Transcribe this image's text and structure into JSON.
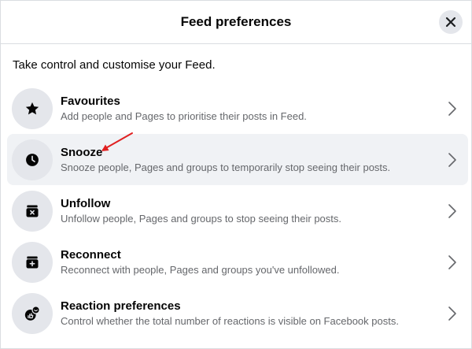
{
  "header": {
    "title": "Feed preferences",
    "close_icon": "close-icon"
  },
  "intro": "Take control and customise your Feed.",
  "items": [
    {
      "title": "Favourites",
      "description": "Add people and Pages to prioritise their posts in Feed.",
      "icon": "star-icon",
      "highlighted": false
    },
    {
      "title": "Snooze",
      "description": "Snooze people, Pages and groups to temporarily stop seeing their posts.",
      "icon": "clock-icon",
      "highlighted": true
    },
    {
      "title": "Unfollow",
      "description": "Unfollow people, Pages and groups to stop seeing their posts.",
      "icon": "unfollow-box-icon",
      "highlighted": false
    },
    {
      "title": "Reconnect",
      "description": "Reconnect with people, Pages and groups you've unfollowed.",
      "icon": "reconnect-box-icon",
      "highlighted": false
    },
    {
      "title": "Reaction preferences",
      "description": "Control whether the total number of reactions is visible on Facebook posts.",
      "icon": "reaction-icon",
      "highlighted": false
    }
  ],
  "colors": {
    "highlight_bg": "#f0f2f5",
    "icon_bg": "#e4e6eb",
    "annotation_arrow": "#e02020"
  }
}
